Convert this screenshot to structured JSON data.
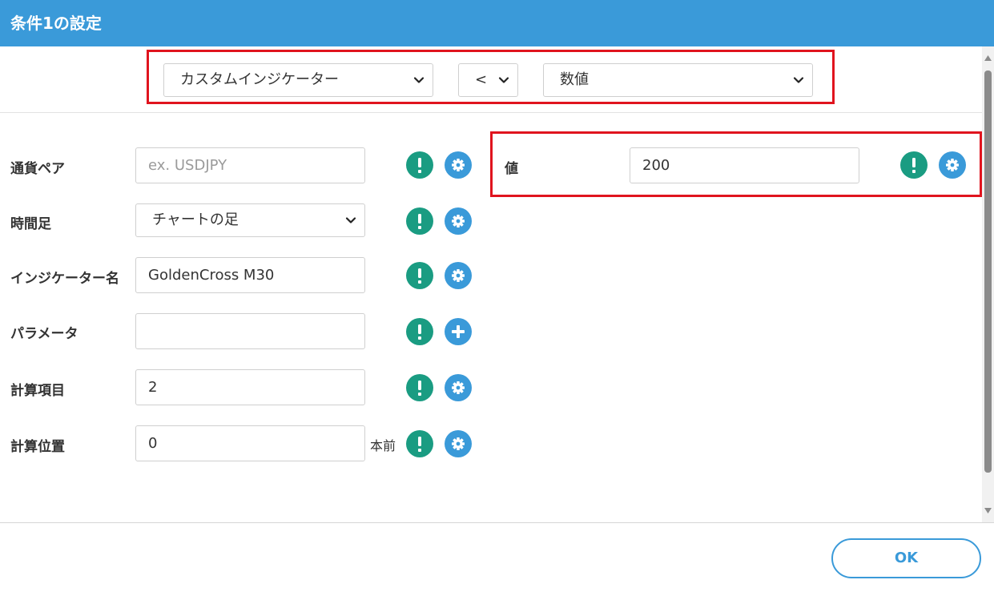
{
  "dialog": {
    "title": "条件1の設定"
  },
  "condition": {
    "left_select": "カスタムインジケーター",
    "operator_select": "<",
    "right_select": "数値"
  },
  "fields": {
    "currency_pair": {
      "label": "通貨ペア",
      "placeholder": "ex. USDJPY",
      "value": ""
    },
    "timeframe": {
      "label": "時間足",
      "value": "チャートの足"
    },
    "indicator_name": {
      "label": "インジケーター名",
      "value": "GoldenCross M30"
    },
    "parameters": {
      "label": "パラメータ",
      "value": ""
    },
    "calc_item": {
      "label": "計算項目",
      "value": "2"
    },
    "calc_position": {
      "label": "計算位置",
      "value": "0",
      "suffix": "本前"
    }
  },
  "value_field": {
    "label": "値",
    "value": "200"
  },
  "footer": {
    "ok_label": "OK"
  },
  "colors": {
    "header": "#3a9ad9",
    "info_icon": "#1a9c82",
    "action_icon": "#3a9ad9",
    "highlight": "#e0141e"
  },
  "icons": {
    "info": "exclamation-icon",
    "settings": "gear-icon",
    "add": "plus-icon",
    "dropdown": "chevron-down-icon"
  }
}
